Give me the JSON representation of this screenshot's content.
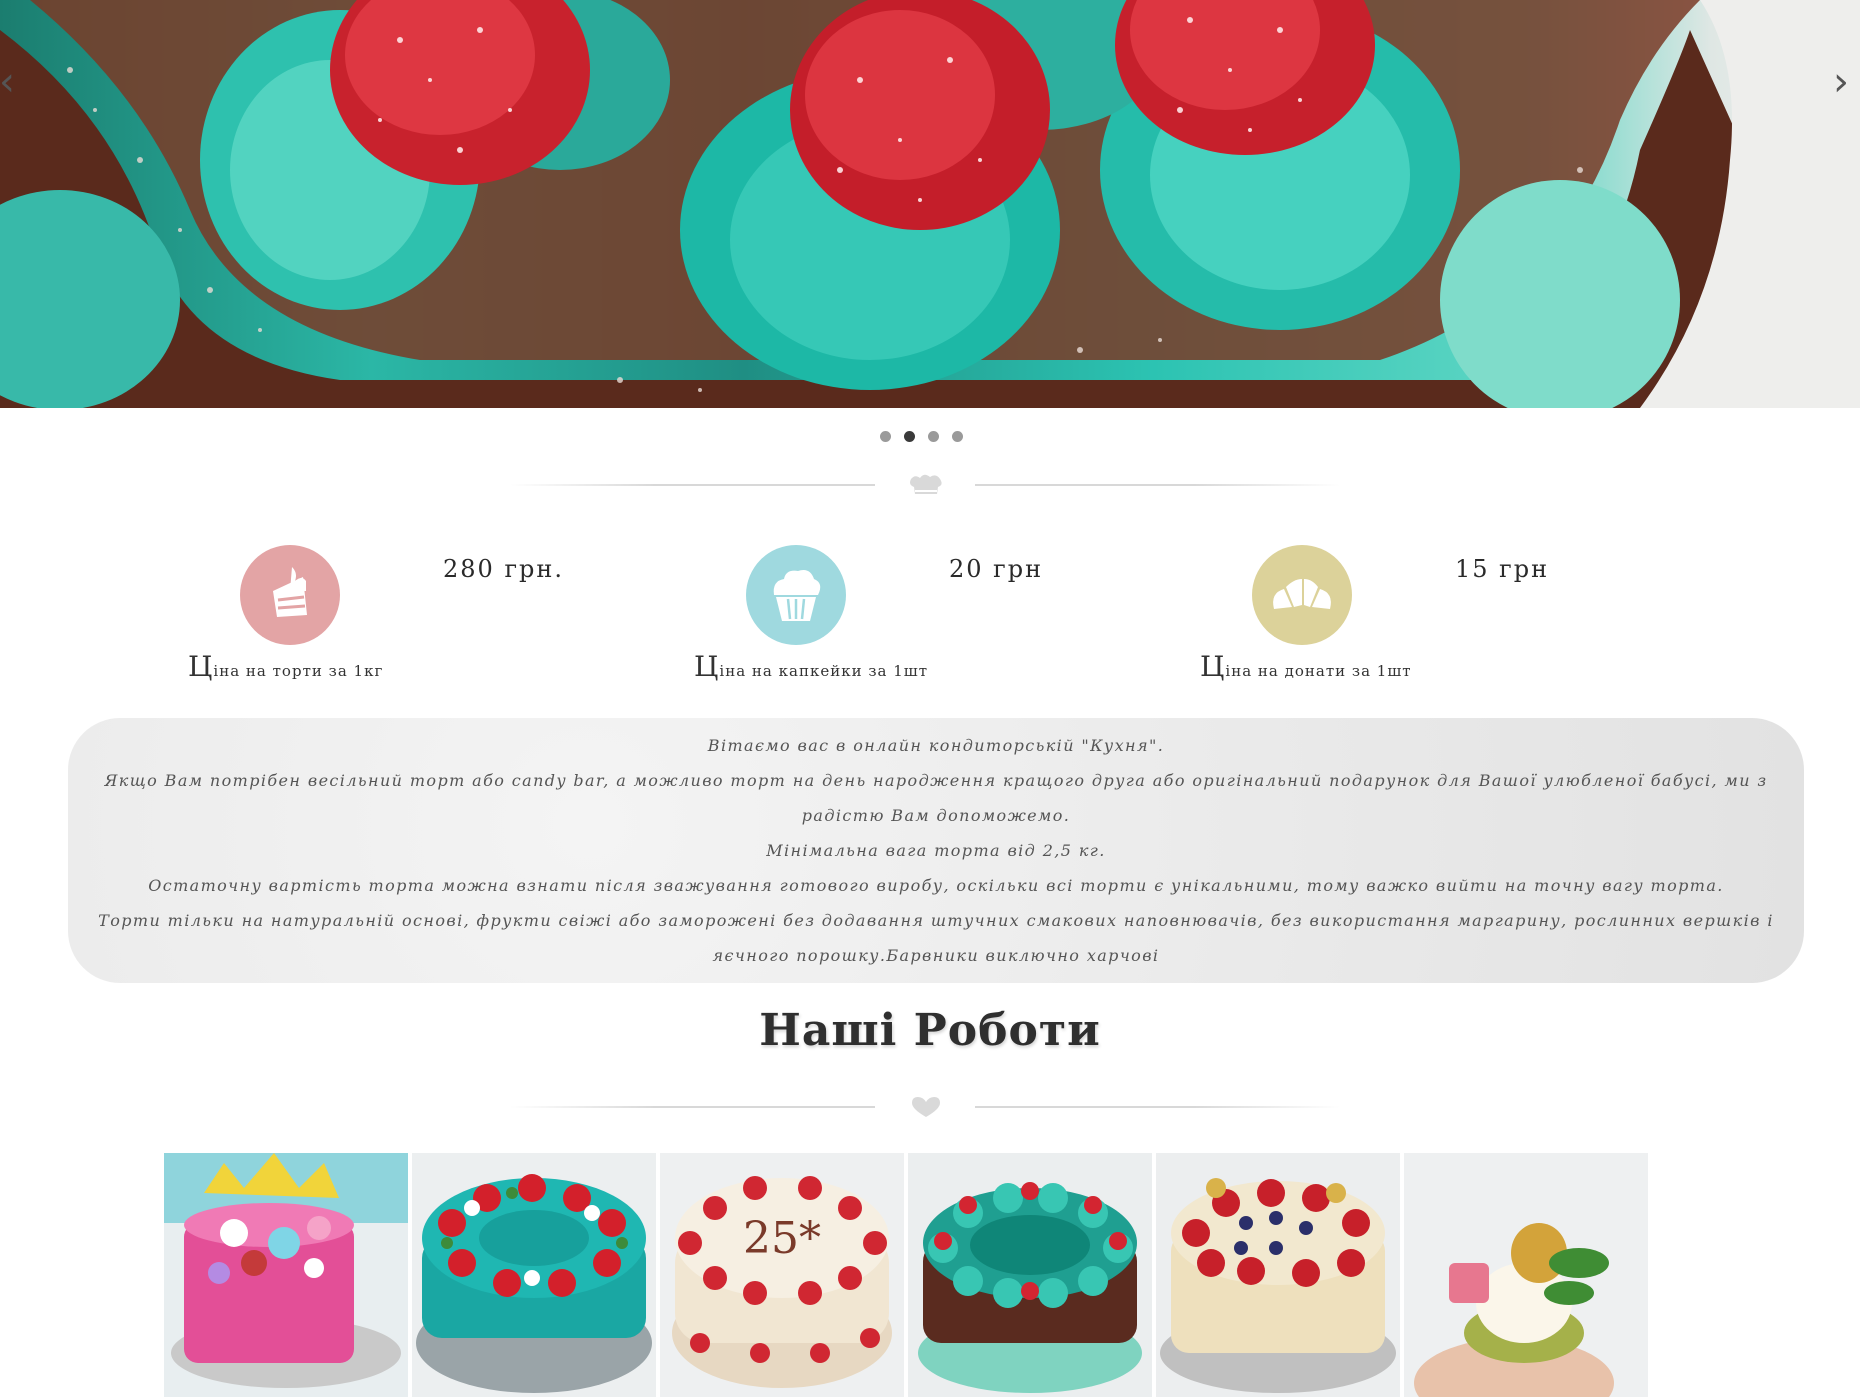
{
  "slider": {
    "prev_icon": "chevron-left-icon",
    "next_icon": "chevron-right-icon",
    "prev_label": "‹",
    "next_label": "›",
    "dots_count": 4,
    "active_dot": 2
  },
  "dividers": {
    "top_icon": "chef-hat-icon",
    "works_icon": "heart-icon"
  },
  "prices": [
    {
      "value": "280 грн.",
      "caption": "Ціна на торти за 1кг",
      "icon": "cake-slice-icon",
      "color": "#e3a4a5"
    },
    {
      "value": "20 грн",
      "caption": "Ціна на капкейки за 1шт",
      "icon": "cupcake-icon",
      "color": "#9fd9df"
    },
    {
      "value": "15 грн",
      "caption": "Ціна на донати за 1шт",
      "icon": "croissant-icon",
      "color": "#dcd29a"
    }
  ],
  "about": {
    "line1": "Вітаємо вас в онлайн кондиторській \"Кухня\".",
    "line2": "Якщо Вам потрібен весільний торт або candy bar, а можливо торт на день народження кращого друга або оригінальний подарунок для Вашої улюбленої бабусі, ми з радістю Вам допоможемо.",
    "line3": "Мінімальна вага торта від 2,5 кг.",
    "line4": "Остаточну вартість торта можна взнати після зважування готового виробу, оскільки всі торти є унікальними, тому важко вийти на точну вагу торта.",
    "line5": "Торти тільки на натуральній основі, фрукти свіжі або заморожені без додавання штучних смакових наповнювачів, без використання маргарину, рослинних вершків і яєчного порошку.Барвники виключно харчові"
  },
  "works": {
    "title": "Наші Роботи",
    "items": [
      {
        "name": "crown-cake"
      },
      {
        "name": "turquoise-strawberry-cake"
      },
      {
        "name": "anniversary-25-cake"
      },
      {
        "name": "teal-cream-cake"
      },
      {
        "name": "berry-crown-cake"
      },
      {
        "name": "cupcake-hand"
      }
    ]
  },
  "colors": {
    "accent_teal": "#2bb7a6",
    "text_dark": "#2f2f2f",
    "about_bg": "#ebebeb"
  }
}
